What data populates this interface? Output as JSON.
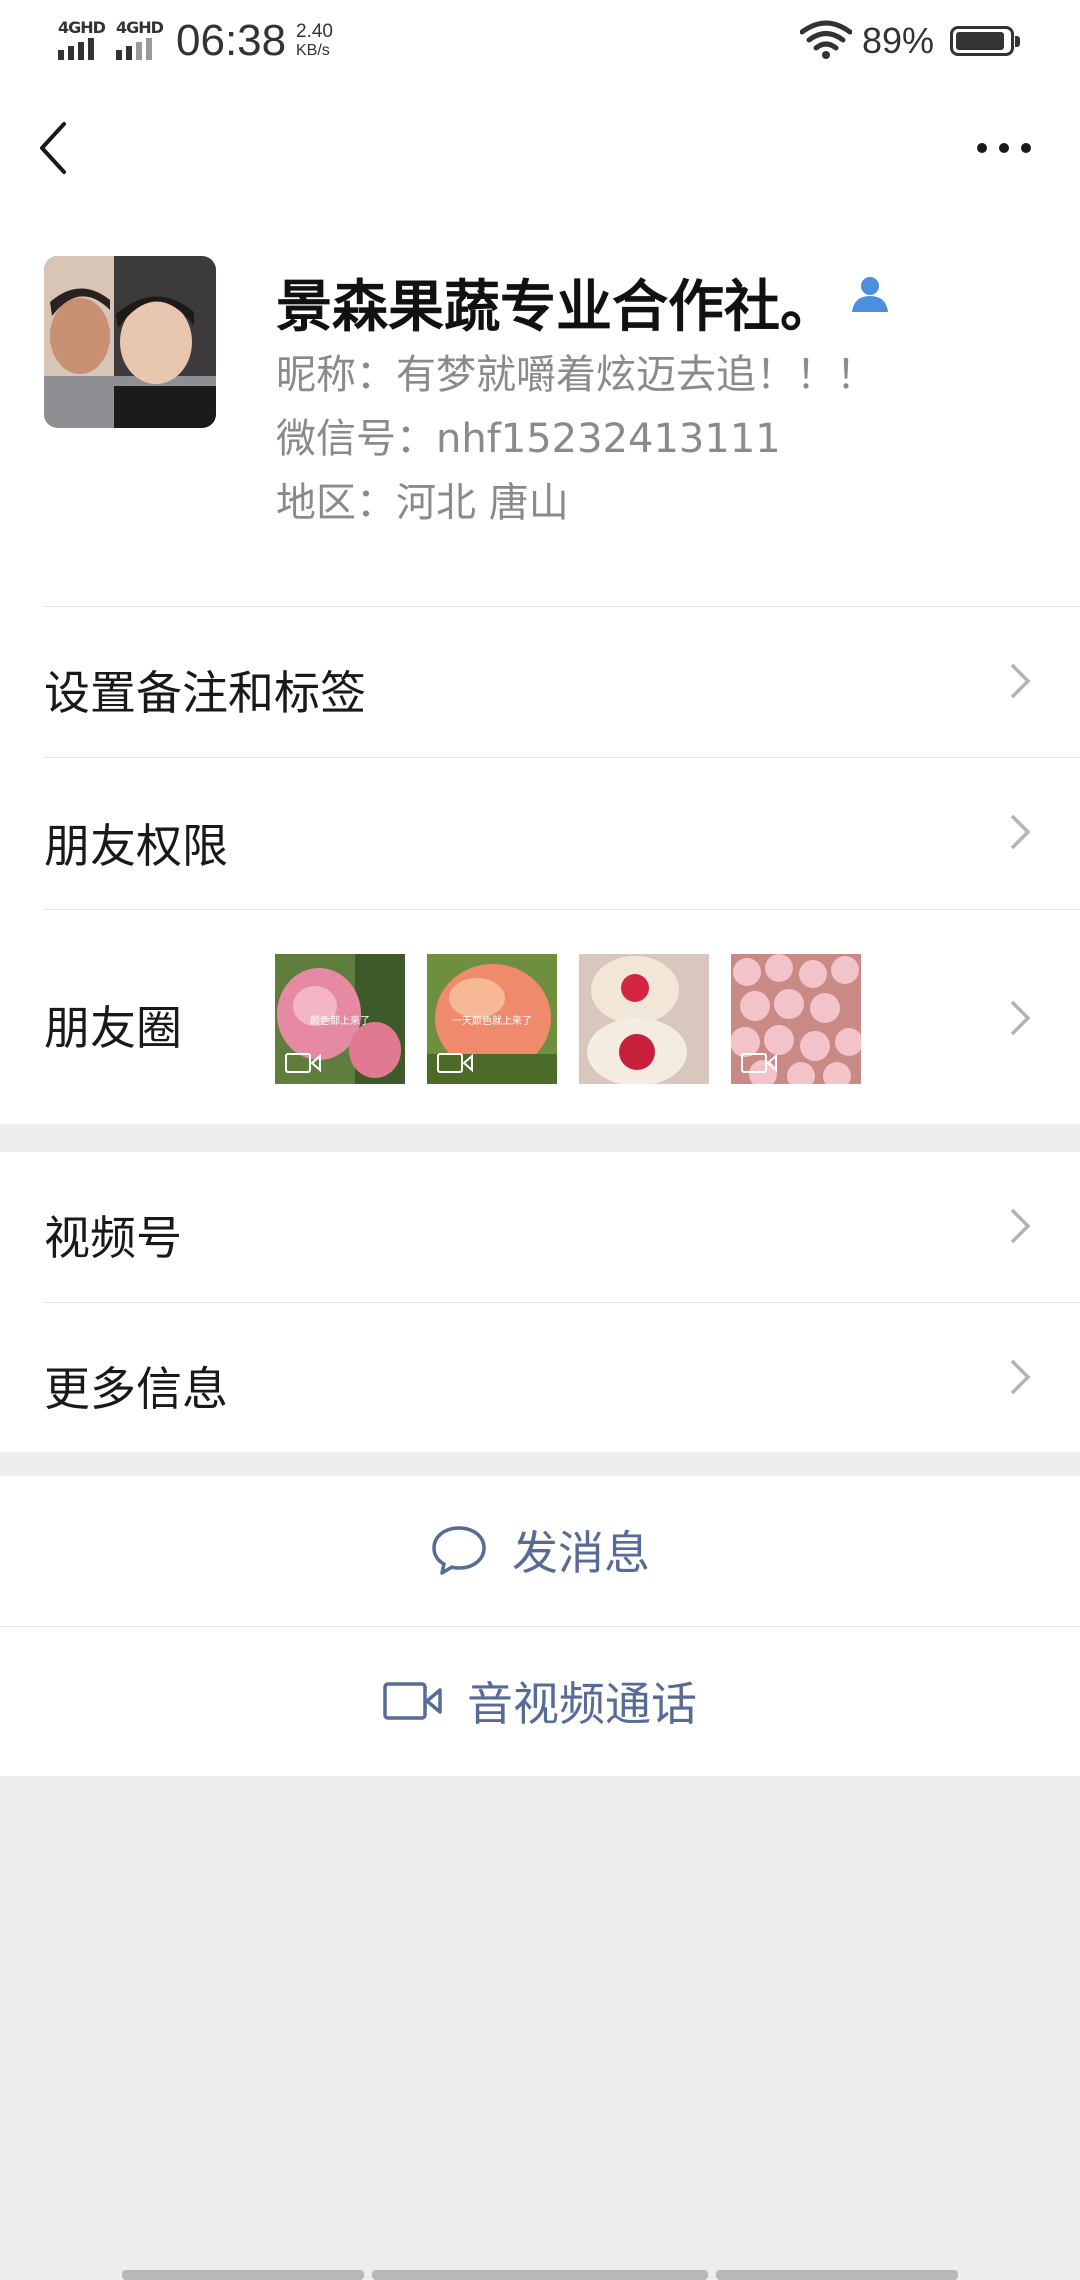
{
  "status_bar": {
    "sim1": "4GHD",
    "sim2": "4GHD",
    "time": "06:38",
    "speed_value": "2.40",
    "speed_unit": "KB/s",
    "battery": "89%"
  },
  "icons": {
    "back": "back-arrow-icon",
    "more": "more-dots-icon",
    "person": "person-icon",
    "chat": "chat-bubble-icon",
    "video": "video-camera-icon"
  },
  "colors": {
    "link": "#576b95",
    "background": "#ededed",
    "person_icon": "#4a8fe0"
  },
  "profile": {
    "name": "景森果蔬专业合作社。",
    "nickname": "昵称：有梦就嚼着炫迈去追！！！",
    "wechat_id": "微信号：nhf15232413111",
    "region": "地区：河北  唐山"
  },
  "rows": {
    "remarks": "设置备注和标签",
    "permissions": "朋友权限",
    "moments": "朋友圈",
    "channels": "视频号",
    "more_info": "更多信息"
  },
  "moments_thumbs": [
    {
      "caption": "颜色都上来了"
    },
    {
      "caption": "一天颜色就上来了"
    },
    {
      "caption": ""
    },
    {
      "caption": ""
    }
  ],
  "actions": {
    "message": "发消息",
    "call": "音视频通话"
  }
}
